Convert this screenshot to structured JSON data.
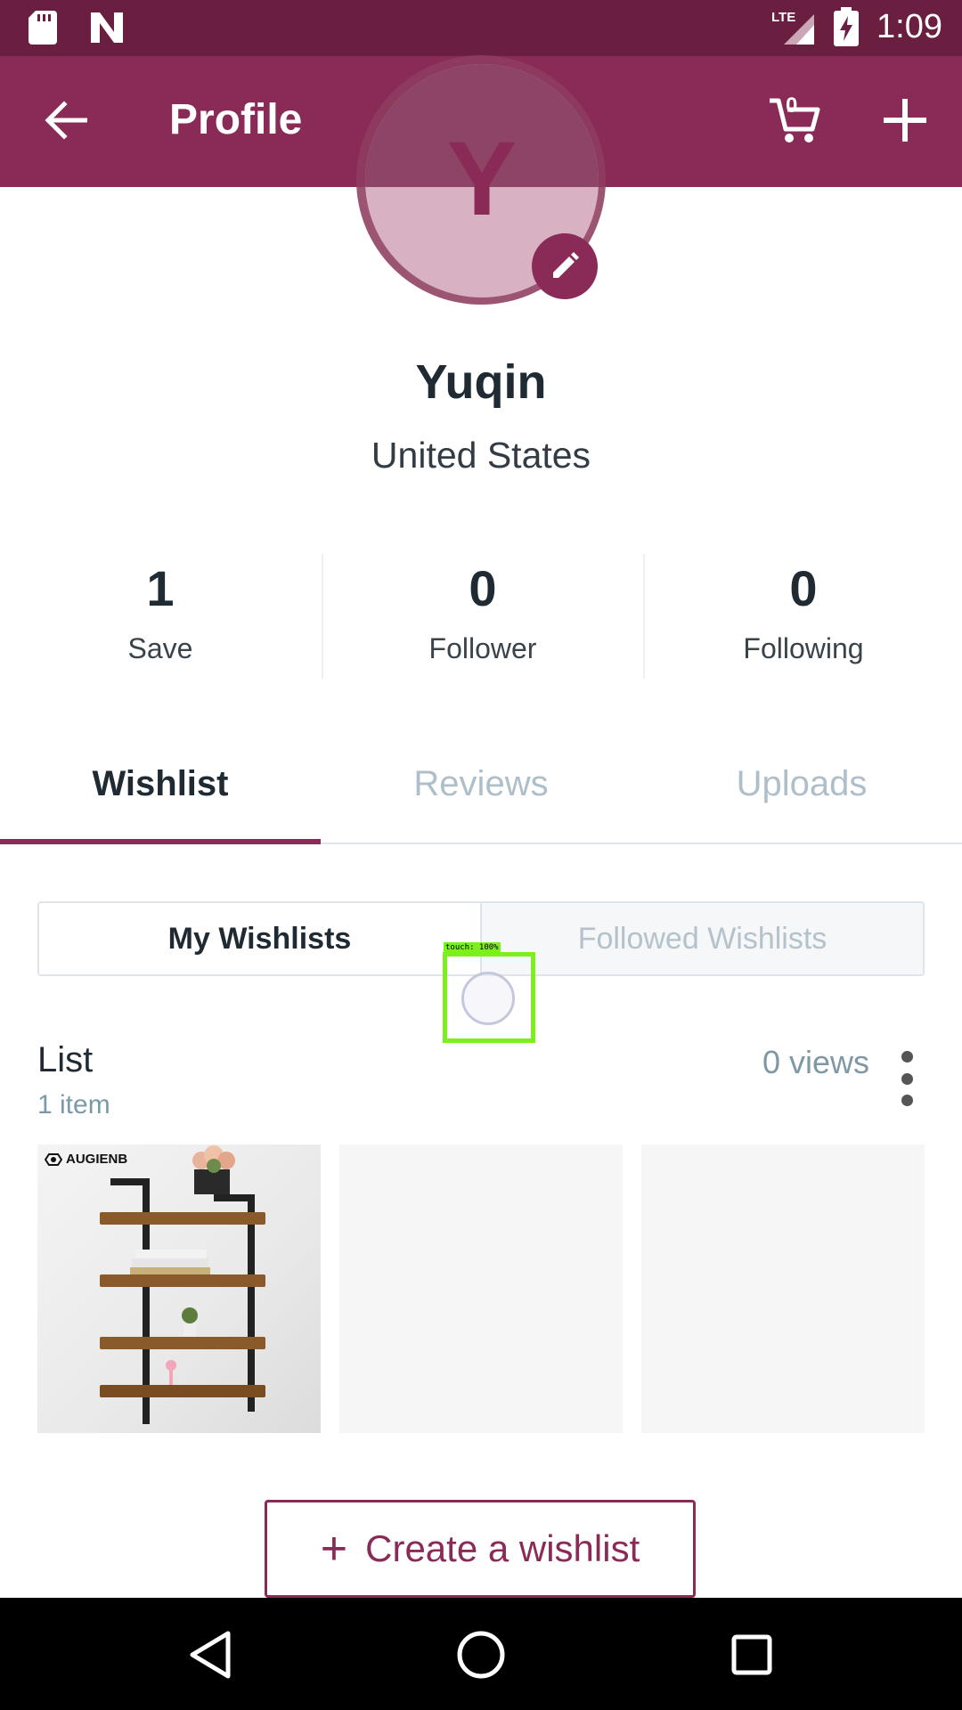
{
  "status_bar": {
    "time": "1:09",
    "network": "LTE",
    "icons": [
      "sd-card-icon",
      "n-notification-icon",
      "lte-signal-icon",
      "battery-charging-icon"
    ]
  },
  "app_bar": {
    "title": "Profile",
    "cart_count": "0",
    "icons": [
      "back-arrow-icon",
      "cart-icon",
      "plus-icon"
    ]
  },
  "profile": {
    "avatar_letter": "Y",
    "name": "Yuqin",
    "location": "United States"
  },
  "stats": [
    {
      "value": "1",
      "label": "Save"
    },
    {
      "value": "0",
      "label": "Follower"
    },
    {
      "value": "0",
      "label": "Following"
    }
  ],
  "tabs": [
    {
      "label": "Wishlist",
      "active": true
    },
    {
      "label": "Reviews",
      "active": false
    },
    {
      "label": "Uploads",
      "active": false
    }
  ],
  "segments": [
    {
      "label": "My Wishlists",
      "active": true
    },
    {
      "label": "Followed Wishlists",
      "active": false
    }
  ],
  "touch_overlay": {
    "label": "touch: 100%"
  },
  "list": {
    "title": "List",
    "count": "1 item",
    "views": "0 views"
  },
  "thumbnail": {
    "brand": "AUGIENB"
  },
  "create_button": {
    "plus": "+",
    "label": "Create a wishlist"
  },
  "colors": {
    "status_bar": "#6a1f40",
    "app_bar": "#8a2b57",
    "accent": "#8a2b57",
    "touch_overlay": "#7cf01c"
  }
}
